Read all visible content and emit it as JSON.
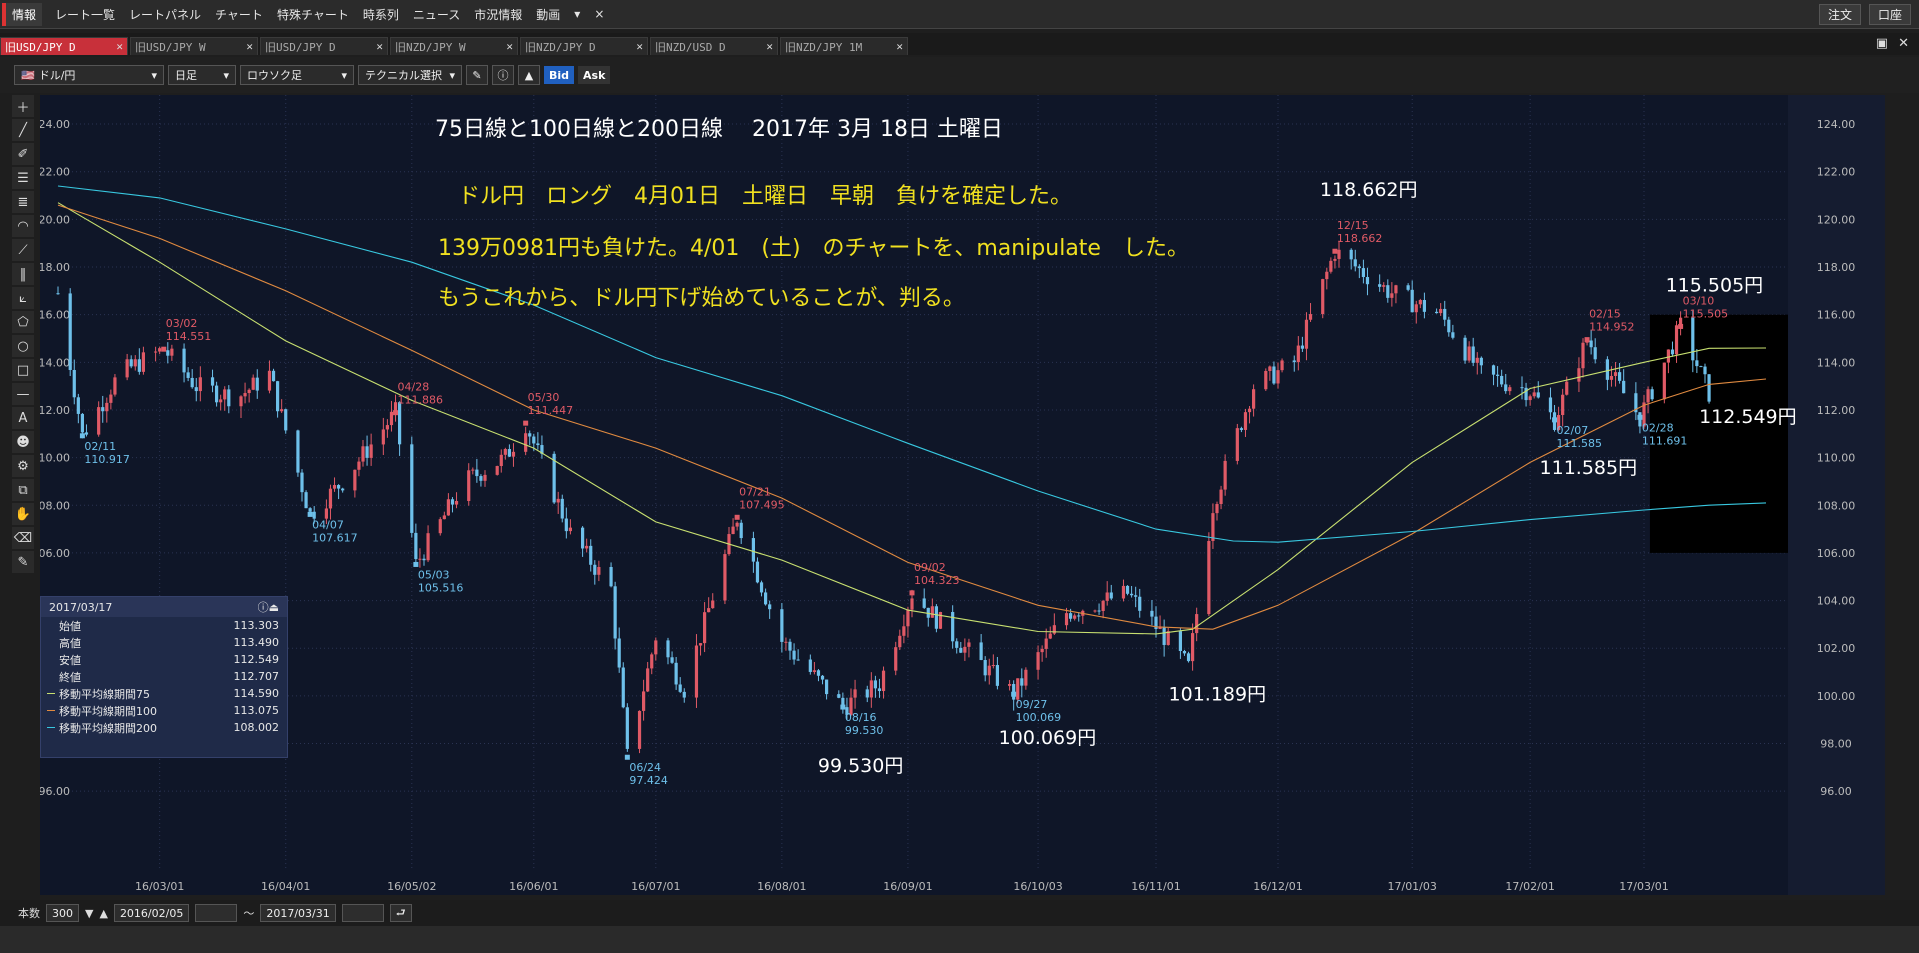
{
  "menubar": {
    "logo": "情報",
    "items": [
      "レート一覧",
      "レートパネル",
      "チャート",
      "特殊チャート",
      "時系列",
      "ニュース",
      "市況情報",
      "動画"
    ],
    "more": "▾",
    "close": "×",
    "right_buttons": [
      "注文",
      "口座"
    ]
  },
  "tabs": [
    {
      "label": "旧USD/JPY D",
      "active": true
    },
    {
      "label": "旧USD/JPY W",
      "active": false
    },
    {
      "label": "旧USD/JPY D",
      "active": false
    },
    {
      "label": "旧NZD/JPY W",
      "active": false
    },
    {
      "label": "旧NZD/JPY D",
      "active": false
    },
    {
      "label": "旧NZD/USD D",
      "active": false
    },
    {
      "label": "旧NZD/JPY 1M",
      "active": false
    }
  ],
  "toolbar": {
    "pair": "ドル/円",
    "period": "日足",
    "style": "ロウソク足",
    "technical": "テクニカル選択",
    "bid": "Bid",
    "ask": "Ask"
  },
  "chart_data": {
    "type": "candlestick",
    "y_ticks": [
      "124.00",
      "122.00",
      "120.00",
      "118.00",
      "116.00",
      "114.00",
      "112.00",
      "110.00",
      "108.00",
      "106.00",
      "104.00",
      "102.00",
      "100.00",
      "98.00",
      "96.00"
    ],
    "ylim": [
      95.0,
      124.8
    ],
    "x_ticks": [
      {
        "label": "16/03/01",
        "date": "2016-03-01"
      },
      {
        "label": "16/04/01",
        "date": "2016-04-01"
      },
      {
        "label": "16/05/02",
        "date": "2016-05-02"
      },
      {
        "label": "16/06/01",
        "date": "2016-06-01"
      },
      {
        "label": "16/07/01",
        "date": "2016-07-01"
      },
      {
        "label": "16/08/01",
        "date": "2016-08-01"
      },
      {
        "label": "16/09/01",
        "date": "2016-09-01"
      },
      {
        "label": "16/10/03",
        "date": "2016-10-03"
      },
      {
        "label": "16/11/01",
        "date": "2016-11-01"
      },
      {
        "label": "16/12/01",
        "date": "2016-12-01"
      },
      {
        "label": "17/01/03",
        "date": "2017-01-03"
      },
      {
        "label": "17/02/01",
        "date": "2017-02-01"
      },
      {
        "label": "17/03/01",
        "date": "2017-03-01"
      }
    ],
    "xlim": [
      "2016-02-05",
      "2017-03-31"
    ],
    "price_path": [
      [
        "2016-02-05",
        116.9
      ],
      [
        "2016-02-11",
        110.917
      ],
      [
        "2016-02-20",
        113.5
      ],
      [
        "2016-03-02",
        114.551
      ],
      [
        "2016-03-10",
        113.0
      ],
      [
        "2016-03-20",
        112.5
      ],
      [
        "2016-03-28",
        113.5
      ],
      [
        "2016-04-07",
        107.617
      ],
      [
        "2016-04-15",
        109.0
      ],
      [
        "2016-04-28",
        111.886
      ],
      [
        "2016-05-03",
        105.516
      ],
      [
        "2016-05-15",
        109.0
      ],
      [
        "2016-05-25",
        110.0
      ],
      [
        "2016-05-30",
        111.447
      ],
      [
        "2016-06-10",
        106.8
      ],
      [
        "2016-06-20",
        104.5
      ],
      [
        "2016-06-24",
        97.424
      ],
      [
        "2016-07-01",
        102.5
      ],
      [
        "2016-07-08",
        100.3
      ],
      [
        "2016-07-21",
        107.495
      ],
      [
        "2016-08-01",
        102.3
      ],
      [
        "2016-08-16",
        99.53
      ],
      [
        "2016-08-25",
        100.5
      ],
      [
        "2016-09-02",
        104.323
      ],
      [
        "2016-09-15",
        102.0
      ],
      [
        "2016-09-27",
        100.069
      ],
      [
        "2016-10-10",
        103.5
      ],
      [
        "2016-10-25",
        104.3
      ],
      [
        "2016-11-03",
        102.5
      ],
      [
        "2016-11-09",
        101.189
      ],
      [
        "2016-11-15",
        108.0
      ],
      [
        "2016-11-25",
        113.0
      ],
      [
        "2016-12-05",
        114.0
      ],
      [
        "2016-12-15",
        118.662
      ],
      [
        "2016-12-28",
        117.0
      ],
      [
        "2017-01-10",
        116.0
      ],
      [
        "2017-01-20",
        113.5
      ],
      [
        "2017-02-01",
        112.8
      ],
      [
        "2017-02-07",
        111.585
      ],
      [
        "2017-02-15",
        114.952
      ],
      [
        "2017-02-28",
        111.691
      ],
      [
        "2017-03-10",
        115.505
      ],
      [
        "2017-03-17",
        112.707
      ]
    ],
    "highs_lows": [
      {
        "date": "2016-02-11",
        "value": 110.917,
        "date_label": "02/11",
        "kind": "low"
      },
      {
        "date": "2016-03-02",
        "value": 114.551,
        "date_label": "03/02",
        "kind": "high"
      },
      {
        "date": "2016-04-07",
        "value": 107.617,
        "date_label": "04/07",
        "kind": "low"
      },
      {
        "date": "2016-04-28",
        "value": 111.886,
        "date_label": "04/28",
        "kind": "high"
      },
      {
        "date": "2016-05-03",
        "value": 105.516,
        "date_label": "05/03",
        "kind": "low"
      },
      {
        "date": "2016-05-30",
        "value": 111.447,
        "date_label": "05/30",
        "kind": "high"
      },
      {
        "date": "2016-06-24",
        "value": 97.424,
        "date_label": "06/24",
        "kind": "low"
      },
      {
        "date": "2016-07-21",
        "value": 107.495,
        "date_label": "07/21",
        "kind": "high"
      },
      {
        "date": "2016-08-16",
        "value": 99.53,
        "date_label": "08/16",
        "kind": "low"
      },
      {
        "date": "2016-09-02",
        "value": 104.323,
        "date_label": "09/02",
        "kind": "high"
      },
      {
        "date": "2016-09-27",
        "value": 100.069,
        "date_label": "09/27",
        "kind": "low"
      },
      {
        "date": "2016-12-15",
        "value": 118.662,
        "date_label": "12/15",
        "kind": "high"
      },
      {
        "date": "2017-02-07",
        "value": 111.585,
        "date_label": "02/07",
        "kind": "low"
      },
      {
        "date": "2017-02-15",
        "value": 114.952,
        "date_label": "02/15",
        "kind": "high"
      },
      {
        "date": "2017-02-28",
        "value": 111.691,
        "date_label": "02/28",
        "kind": "low"
      },
      {
        "date": "2017-03-10",
        "value": 115.505,
        "date_label": "03/10",
        "kind": "high"
      }
    ],
    "ma_series": [
      {
        "name": "移動平均線期間75",
        "color": "#c8e070",
        "points": [
          [
            "2016-02-05",
            120.7
          ],
          [
            "2016-03-01",
            118.2
          ],
          [
            "2016-04-01",
            114.9
          ],
          [
            "2016-05-02",
            112.4
          ],
          [
            "2016-06-01",
            110.4
          ],
          [
            "2016-07-01",
            107.3
          ],
          [
            "2016-08-01",
            105.7
          ],
          [
            "2016-09-01",
            103.6
          ],
          [
            "2016-10-03",
            102.7
          ],
          [
            "2016-11-01",
            102.6
          ],
          [
            "2016-11-10",
            102.8
          ],
          [
            "2016-12-01",
            105.3
          ],
          [
            "2017-01-03",
            109.8
          ],
          [
            "2017-02-01",
            112.9
          ],
          [
            "2017-03-01",
            114.0
          ],
          [
            "2017-03-17",
            114.59
          ],
          [
            "2017-03-31",
            114.6
          ]
        ]
      },
      {
        "name": "移動平均線期間100",
        "color": "#e08a40",
        "points": [
          [
            "2016-02-05",
            120.6
          ],
          [
            "2016-03-01",
            119.2
          ],
          [
            "2016-04-01",
            117.0
          ],
          [
            "2016-05-02",
            114.5
          ],
          [
            "2016-06-01",
            112.0
          ],
          [
            "2016-07-01",
            110.4
          ],
          [
            "2016-08-01",
            108.3
          ],
          [
            "2016-09-01",
            105.6
          ],
          [
            "2016-10-03",
            103.8
          ],
          [
            "2016-11-01",
            102.9
          ],
          [
            "2016-11-15",
            102.8
          ],
          [
            "2016-12-01",
            103.8
          ],
          [
            "2017-01-03",
            106.8
          ],
          [
            "2017-02-01",
            109.8
          ],
          [
            "2017-03-01",
            112.2
          ],
          [
            "2017-03-17",
            113.075
          ],
          [
            "2017-03-31",
            113.3
          ]
        ]
      },
      {
        "name": "移動平均線期間200",
        "color": "#38c8e0",
        "points": [
          [
            "2016-02-05",
            121.4
          ],
          [
            "2016-03-01",
            120.9
          ],
          [
            "2016-04-01",
            119.6
          ],
          [
            "2016-05-02",
            118.2
          ],
          [
            "2016-06-01",
            116.4
          ],
          [
            "2016-07-01",
            114.2
          ],
          [
            "2016-08-01",
            112.6
          ],
          [
            "2016-09-01",
            110.6
          ],
          [
            "2016-10-03",
            108.6
          ],
          [
            "2016-11-01",
            107.0
          ],
          [
            "2016-11-20",
            106.5
          ],
          [
            "2016-12-01",
            106.45
          ],
          [
            "2017-01-03",
            106.9
          ],
          [
            "2017-02-01",
            107.4
          ],
          [
            "2017-03-01",
            107.8
          ],
          [
            "2017-03-17",
            108.002
          ],
          [
            "2017-03-31",
            108.1
          ]
        ]
      }
    ],
    "annotations": {
      "title": "75日線と100日線と200日線　 2017年 3月 18日 土曜日",
      "line1": "ドル円　ロング　4月01日　土曜日　早朝　負けを確定した。",
      "line2": "139万0981円も負けた。4/01　(土)　のチャートを、manipulate　した。",
      "line3": "もうこれから、ドル円下げ始めていることが、判る。",
      "big_labels": [
        {
          "text": "118.662円",
          "date": "2016-12-15",
          "value": 118.662
        },
        {
          "text": "115.505円",
          "date": "2017-03-10",
          "value": 115.505
        },
        {
          "text": "112.549円",
          "date": "2017-03-17",
          "value": 112.549
        },
        {
          "text": "111.585円",
          "date": "2017-02-07",
          "value": 111.585
        },
        {
          "text": "101.189円",
          "date": "2016-11-09",
          "value": 101.189
        },
        {
          "text": "100.069円",
          "date": "2016-09-27",
          "value": 100.069
        },
        {
          "text": "99.530円",
          "date": "2016-08-16",
          "value": 99.53
        }
      ]
    }
  },
  "infopanel": {
    "date": "2017/03/17",
    "rows": [
      {
        "label": "始値",
        "value": "113.303",
        "color": ""
      },
      {
        "label": "高値",
        "value": "113.490",
        "color": ""
      },
      {
        "label": "安値",
        "value": "112.549",
        "color": ""
      },
      {
        "label": "終値",
        "value": "112.707",
        "color": ""
      },
      {
        "label": "移動平均線期間75",
        "value": "114.590",
        "color": "#c8e070"
      },
      {
        "label": "移動平均線期間100",
        "value": "113.075",
        "color": "#e08a40"
      },
      {
        "label": "移動平均線期間200",
        "value": "108.002",
        "color": "#38c8e0"
      }
    ]
  },
  "bottombar": {
    "count_label": "本数",
    "count": "300",
    "from": "2016/02/05",
    "tilde": "～",
    "to": "2017/03/31"
  },
  "colors": {
    "up": "#e05a66",
    "down": "#6ec0ea",
    "bg": "#0f1628",
    "grid": "#2a3352",
    "text": "#ffffff",
    "yellow": "#f0e020"
  }
}
